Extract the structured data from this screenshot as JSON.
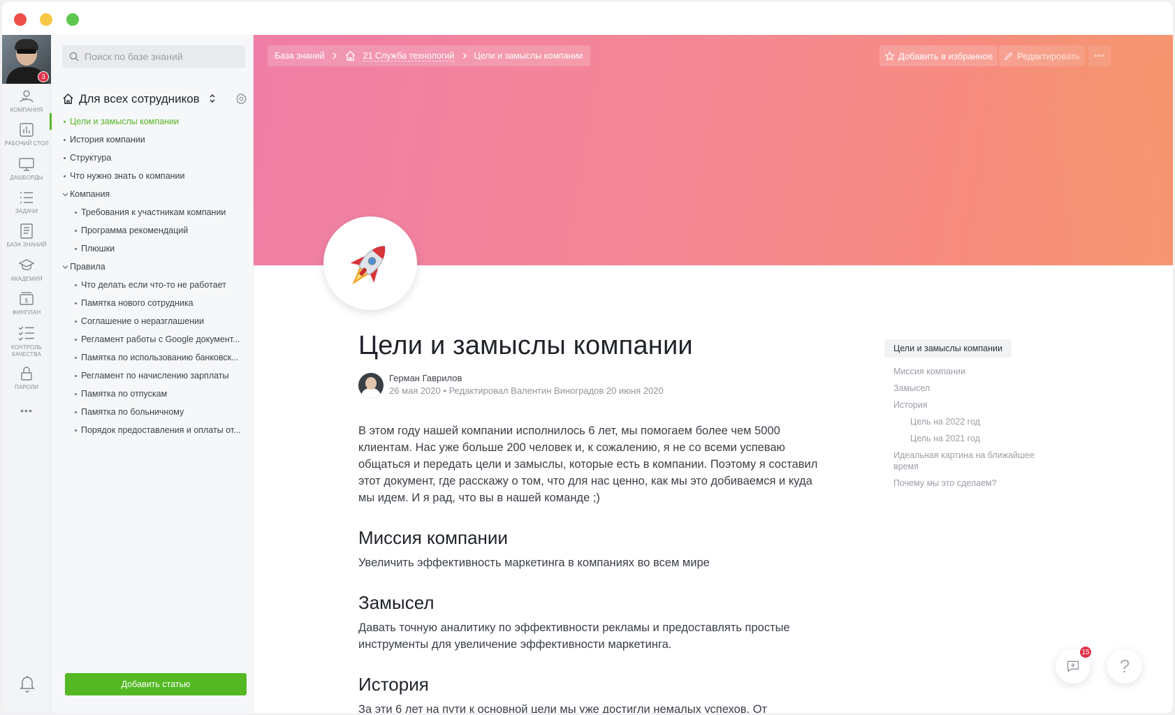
{
  "window": {
    "traffic_lights": [
      "close",
      "minimize",
      "maximize"
    ]
  },
  "user": {
    "notifications_badge": "3"
  },
  "rail": {
    "items": [
      {
        "label": "КОМПАНИЯ",
        "icon": "company-icon"
      },
      {
        "label": "РАБОЧИЙ СТОЛ",
        "icon": "desktop-chart-icon"
      },
      {
        "label": "ДАШБОРДЫ",
        "icon": "monitor-icon"
      },
      {
        "label": "ЗАДАЧИ",
        "icon": "tasks-list-icon"
      },
      {
        "label": "БАЗА ЗНАНИЙ",
        "icon": "knowledge-base-icon"
      },
      {
        "label": "АКАДЕМИЯ",
        "icon": "academy-cap-icon"
      },
      {
        "label": "ФИНПЛАН",
        "icon": "finplan-icon"
      },
      {
        "label": "КОНТРОЛЬ КАЧЕСТВА",
        "icon": "quality-check-icon"
      },
      {
        "label": "ПАРОЛИ",
        "icon": "lock-icon"
      }
    ],
    "more": "•••"
  },
  "sidebar": {
    "search_placeholder": "Поиск по базе знаний",
    "space_title": "Для всех сотрудников",
    "tree": [
      {
        "label": "Цели и замыслы компании",
        "level": 1,
        "active": true
      },
      {
        "label": "История компании",
        "level": 1
      },
      {
        "label": "Структура",
        "level": 1
      },
      {
        "label": "Что нужно знать о компании",
        "level": 1
      },
      {
        "label": "Компания",
        "level": 1,
        "folder": true
      },
      {
        "label": "Требования к участникам компании",
        "level": 2
      },
      {
        "label": "Программа рекомендаций",
        "level": 2
      },
      {
        "label": "Плюшки",
        "level": 2
      },
      {
        "label": "Правила",
        "level": 1,
        "folder": true
      },
      {
        "label": "Что делать если что-то не работает",
        "level": 2
      },
      {
        "label": "Памятка нового сотрудника",
        "level": 2
      },
      {
        "label": "Соглашение о неразглашении",
        "level": 2
      },
      {
        "label": "Регламент работы с Google документ...",
        "level": 2
      },
      {
        "label": "Памятка по использованию банковск...",
        "level": 2
      },
      {
        "label": "Регламент по начислению зарплаты",
        "level": 2
      },
      {
        "label": "Памятка по отпускам",
        "level": 2
      },
      {
        "label": "Памятка по больничному",
        "level": 2
      },
      {
        "label": "Порядок предоставления и оплаты от...",
        "level": 2
      }
    ],
    "add_button": "Добавить статью"
  },
  "breadcrumbs": {
    "root": "База знаний",
    "space": "21 Служба технологий",
    "current": "Цели и замыслы компании"
  },
  "toolbar": {
    "favorite": "Добавить в избранное",
    "edit": "Редактировать",
    "more": "•••"
  },
  "cover": {
    "gradient_start": "#ef7ea6",
    "gradient_end": "#f59670"
  },
  "article": {
    "title": "Цели и замыслы компании",
    "author": "Герман Гаврилов",
    "meta": "26 мая 2020 • Редактировал Валентин Виноградов 20 июня 2020",
    "intro": "В этом году нашей компании исполнилось 6 лет, мы помогаем более чем 5000 клиентам. Нас уже больше 200 человек и, к сожалению, я не со всеми успеваю общаться и передать цели и замыслы, которые есть в компании. Поэтому я составил этот документ, где расскажу о том, что для нас ценно, как мы это добиваемся и куда мы идем. И я рад, что вы в нашей команде ;)",
    "sections": [
      {
        "heading": "Миссия компании",
        "text": "Увеличить эффективность маркетинга в компаниях во всем мире"
      },
      {
        "heading": "Замысел",
        "text": "Давать точную аналитику по эффективности рекламы и предоставлять простые инструменты для увеличение эффективности маркетинга."
      },
      {
        "heading": "История",
        "text": "За эти 6 лет на пути к основной цели мы уже достигли немалых успехов. От"
      }
    ]
  },
  "toc": {
    "current": "Цели и замыслы компании",
    "items": [
      {
        "label": "Миссия компании",
        "sub": false
      },
      {
        "label": "Замысел",
        "sub": false
      },
      {
        "label": "История",
        "sub": false
      },
      {
        "label": "Цель на 2022 год",
        "sub": true
      },
      {
        "label": "Цель на 2021 год",
        "sub": true
      },
      {
        "label": "Идеальная картина на ближайшее время",
        "sub": false
      },
      {
        "label": "Почему мы это сделаем?",
        "sub": false
      }
    ]
  },
  "fabs": {
    "chat_badge": "15",
    "help": "?"
  },
  "colors": {
    "accent": "#53b822",
    "badge": "#e0334b"
  }
}
